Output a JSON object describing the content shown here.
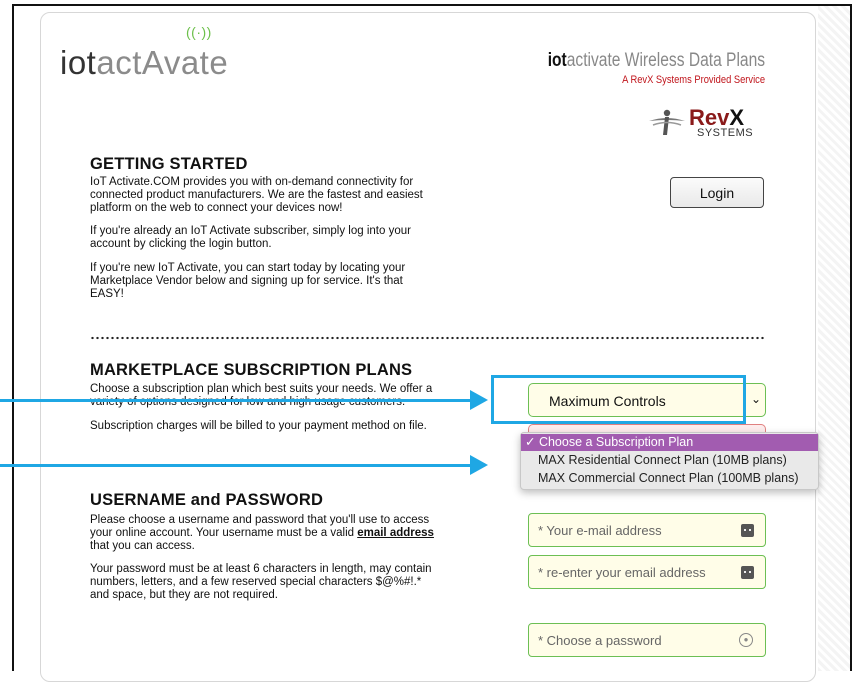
{
  "header": {
    "logo_part1": "iot",
    "logo_part2": "act",
    "logo_tower": "((·))",
    "logo_part3": "A",
    "logo_part4": "vate",
    "brand_bold": "iot",
    "brand_rest": "activate Wireless Data Plans",
    "brand_sub": "A RevX Systems Provided Service",
    "revx_word": "Rev",
    "revx_x": "X",
    "revx_systems": "SYSTEMS"
  },
  "getting_started": {
    "heading": "GETTING STARTED",
    "p1": "IoT Activate.COM provides you with on-demand connectivity for connected product manufacturers. We are the fastest and easiest platform on the web to connect your devices now!",
    "p2": "If you're already an IoT Activate subscriber, simply log into your account by clicking the login button.",
    "p3": "If you're new IoT Activate, you can start today by locating your Marketplace Vendor below and signing up for service. It's that EASY!",
    "login_label": "Login"
  },
  "marketplace": {
    "heading": "MARKETPLACE SUBSCRIPTION PLANS",
    "p1": "Choose a subscription plan which best suits your needs. We offer a variety of options designed for low and high usage customers.",
    "p2": "Subscription charges will be billed to your payment method on file.",
    "vendor_select_value": "Maximum Controls",
    "plan_options": [
      "✓ Choose a Subscription Plan",
      "MAX Residential Connect Plan (10MB plans)",
      "MAX Commercial Connect Plan (100MB plans)"
    ]
  },
  "account": {
    "heading": "USERNAME and PASSWORD",
    "p1_a": "Please choose a username and password that you'll use to access your online account. Your username must be a valid ",
    "p1_link": "email address",
    "p1_b": " that you can access.",
    "p2": "Your password must be at least 6 characters in length, may contain numbers, letters, and a few reserved special characters $@%#!.* and space, but they are not required.",
    "email_placeholder": "* Your e-mail address",
    "email_confirm_placeholder": "* re-enter your email address",
    "password_placeholder": "* Choose a password"
  },
  "colors": {
    "annotation": "#1fa7e4",
    "field_border": "#6cbf54",
    "selected_option": "#a25cb0",
    "brand_red": "#c0141b"
  }
}
